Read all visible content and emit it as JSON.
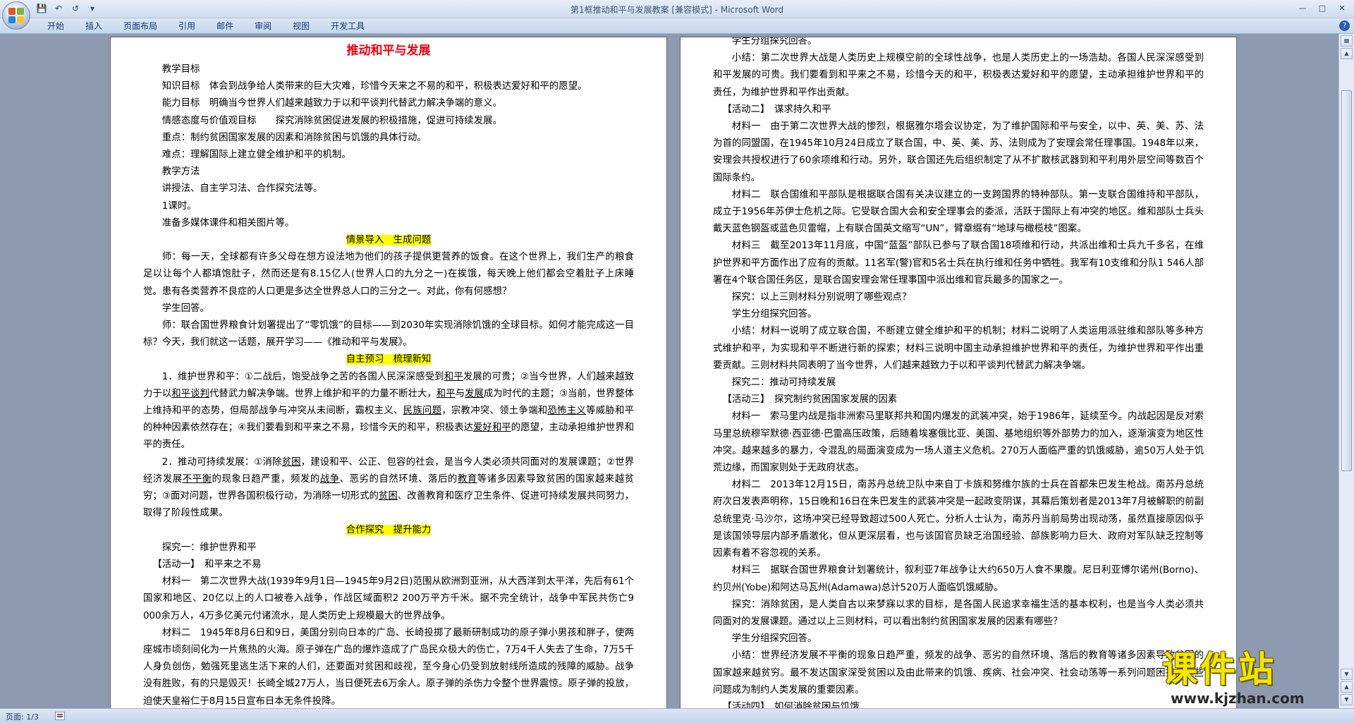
{
  "app": {
    "title": "第1框推动和平与发展教案 [兼容模式] - Microsoft Word"
  },
  "ribbon": {
    "tabs": [
      "开始",
      "插入",
      "页面布局",
      "引用",
      "邮件",
      "审阅",
      "视图",
      "开发工具"
    ]
  },
  "status": {
    "page": "页面: 1/3"
  },
  "watermark": {
    "main": "课件站",
    "url": "www.kjzhan.com"
  },
  "left_page": {
    "title": "推动和平与发展",
    "lines": [
      "教学目标",
      "知识目标　体会到战争给人类带来的巨大灾难，珍惜今天来之不易的和平，积极表达爱好和平的愿望。",
      "能力目标　明确当今世界人们越来越致力于以和平谈判代替武力解决争端的意义。",
      "情感态度与价值观目标　　探究消除贫困促进发展的积极措施，促进可持续发展。",
      "重点：制约贫困国家发展的因素和消除贫困与饥饿的具体行动。",
      "难点：理解国际上建立健全维护和平的机制。",
      "教学方法",
      "讲授法、自主学习法、合作探究法等。",
      "1课时。",
      "准备多媒体课件和相关图片等。"
    ],
    "heading1": "情景导入　生成问题",
    "p1": "师：每一天，全球都有许多父母在想方设法地为他们的孩子提供更营养的饭食。在这个世界上，我们生产的粮食足以让每个人都填饱肚子，然而还是有8.15亿人(世界人口的九分之一)在挨饿，每天晚上他们都会空着肚子上床睡觉。患有各类营养不良症的人口更是多达全世界总人口的三分之一。对此，你有何感想？",
    "p2": "学生回答。",
    "p3": "师：联合国世界粮食计划署提出了“零饥饿”的目标——到2030年实现消除饥饿的全球目标。如何才能完成这一目标？今天，我们就这一话题，展开学习——《推动和平与发展》。",
    "heading2": "自主预习　梳理新知",
    "p4": {
      "a": "1．维护世界和平：①二战后，饱受战争之苦的各国人民深深感受到",
      "b": "和平",
      "c": "发展的可贵；②当今世界，人们越来越致力于以",
      "d": "和平谈判",
      "e": "代替武力解决争端。世界上维护和平的力量不断壮大，",
      "f": "和平",
      "g": "与",
      "h": "发展",
      "i": "成为时代的主题；③当前，世界整体上维持和平的态势，但局部战争与冲突从未间断，霸权主义、",
      "j": "民族问题",
      "k": "，宗教冲突、领土争端和",
      "l": "恐怖主义",
      "m": "等威胁和平的种种因素依然存在；④我们要看到和平来之不易，珍惜今天的和平，积极表达",
      "n": "爱好和平",
      "o": "的愿望，主动承担维护世界和平的责任。"
    },
    "p5": {
      "a": "2．推动可持续发展：①消除",
      "b": "贫困",
      "c": "，建设和平、公正、包容的社会，是当今人类必须共同面对的发展课题；②世界经济发展",
      "d": "不平衡",
      "e": "的现象日趋严重，频发的",
      "f": "战争",
      "g": "、恶劣的自然环境、落后的",
      "h": "教育",
      "i": "等诸多因素导致贫困的国家越来越贫穷；③面对问题，世界各国积极行动，为消除一切形式的",
      "j": "贫困",
      "k": "、改善教育和医疗卫生条件、促进可持续发展共同努力，取得了阶段性成果。"
    },
    "heading3": "合作探究　提升能力",
    "p6": "探究一：维护世界和平",
    "p7": "【活动一】　和平来之不易",
    "p8": "材料一　第二次世界大战(1939年9月1日—1945年9月2日)范围从欧洲到亚洲，从大西洋到太平洋，先后有61个国家和地区、20亿以上的人口被卷入战争，作战区域面积2 200万平方千米。据不完全统计，战争中军民共伤亡9 000余万人，4万多亿美元付诸流水，是人类历史上规模最大的世界战争。",
    "p9": "材料二　1945年8月6日和9日，美国分别向日本的广岛、长崎投掷了最新研制成功的原子弹小男孩和胖子，使两座城市顷刻间化为一片焦热的火海。原子弹在广岛的爆炸造成了广岛民众极大的伤亡，7万4千人失去了生命，7万5千人身负创伤，勉强死里逃生活下来的人们，还要面对贫困和歧视，至今身心仍受到放射线所造成的残障的威胁。战争没有胜败，有的只是毁灭！长崎全城27万人，当日便死去6万余人。原子弹的杀伤力令整个世界震惊。原子弹的投放，迫使天皇裕仁于8月15日宣布日本无条件投降。"
  },
  "right_page": {
    "r1": "学生分组探究回答。",
    "r2": "小结：第二次世界大战是人类历史上规模空前的全球性战争，也是人类历史上的一场浩劫。各国人民深深感受到和平发展的可贵。我们要看到和平来之不易，珍惜今天的和平，积极表达爱好和平的愿望，主动承担维护世界和平的责任，为维护世界和平作出贡献。",
    "r3": "【活动二】　谋求持久和平",
    "r4": "材料一　由于第二次世界大战的惨烈，根据雅尔塔会议协定，为了维护国际和平与安全，以中、英、美、苏、法为首的同盟国，在1945年10月24日成立了联合国，中、英、美、苏、法则成为了安理会常任理事国。1948年以来，安理会共授权进行了60余项维和行动。另外，联合国还先后组织制定了从不扩散核武器到和平利用外层空间等数百个国际条约。",
    "r5": "材料二　联合国维和平部队是根据联合国有关决议建立的一支跨国界的特种部队。第一支联合国维持和平部队，成立于1956年苏伊士危机之际。它受联合国大会和安全理事会的委派，活跃于国际上有冲突的地区。维和部队士兵头戴天蓝色钢盔或蓝色贝雷帽，上有联合国英文缩写“UN”，臂章缀有“地球与橄榄枝”图案。",
    "r6": "材料三　截至2013年11月底，中国“蓝盔”部队已参与了联合国18项维和行动，共派出维和士兵九千多名，在维护世界和平方面作出了应有的贡献。11名军(警)官和5名士兵在执行维和任务中牺牲。我军有10支维和分队1 546人部署在4个联合国任务区，是联合国安理会常任理事国中派出维和官兵最多的国家之一。",
    "r7": "探究：以上三则材料分别说明了哪些观点？",
    "r8": "学生分组探究回答。",
    "r9": "小结：材料一说明了成立联合国，不断建立健全维护和平的机制；材料二说明了人类运用派驻维和部队等多种方式维护和平，为实现和平不断进行新的探索；材料三说明中国主动承担维护世界和平的责任，为维护世界和平作出重要贡献。三则材料共同表明了当今世界，人们越来越致力于以和平谈判代替武力解决争端。",
    "r10": "探究二：推动可持续发展",
    "r11": "【活动三】　探究制约贫困国家发展的因素",
    "r12": "材料一　索马里内战是指非洲索马里联邦共和国内爆发的武装冲突，始于1986年，延续至今。内战起因是反对索马里总统穆罕默德·西亚德·巴雷高压政策，后随着埃塞俄比亚、美国、基地组织等外部势力的加入，逐渐演变为地区性冲突。越来越多的暴力，令混乱的局面演变成为一场人道主义危机。270万人面临严重的饥饿威胁，逾50万人处于饥荒边缘，而国家则处于无政府状态。",
    "r13": "材料二　2013年12月15日，南苏丹总统卫队中来自丁卡族和努维尔族的士兵在首都朱巴发生枪战。南苏丹总统府次日发表声明称，15日晚和16日在朱巴发生的武装冲突是一起政变阴谋，其幕后策划者是2013年7月被解职的前副总统里克·马沙尔，这场冲突已经导致超过500人死亡。分析人士认为，南苏丹当前局势出现动荡，虽然直接原因似乎是该国领导层内部矛盾激化，但从更深层看，也与该国官员缺乏治国经验、部族影响力巨大、政府对军队缺乏控制等因素有着不容忽视的关系。",
    "r14": "材料三　据联合国世界粮食计划署统计，叙利亚7年战争让大约650万人食不果腹。尼日利亚博尔诺州(Borno)、约贝州(Yobe)和阿达马瓦州(Adamawa)总计520万人面临饥饿威胁。",
    "r15": "探究：消除贫困，是人类自古以来梦寐以求的目标，是各国人民追求幸福生活的基本权利，也是当今人类必须共同面对的发展课题。通过以上三则材料，可以看出制约贫困国家发展的因素有哪些？",
    "r16": "学生分组探究回答。",
    "r17": "小结：世界经济发展不平衡的现象日趋严重，频发的战争、恶劣的自然环境、落后的教育等诸多因素导致贫困的国家越来越贫穷。最不发达国家深受贫困以及由此带来的饥饿、疾病、社会冲突、社会动荡等一系列问题困扰。这些问题成为制约人类发展的重要因素。",
    "r18": "【活动四】　如何消除贫困与饥饿"
  }
}
